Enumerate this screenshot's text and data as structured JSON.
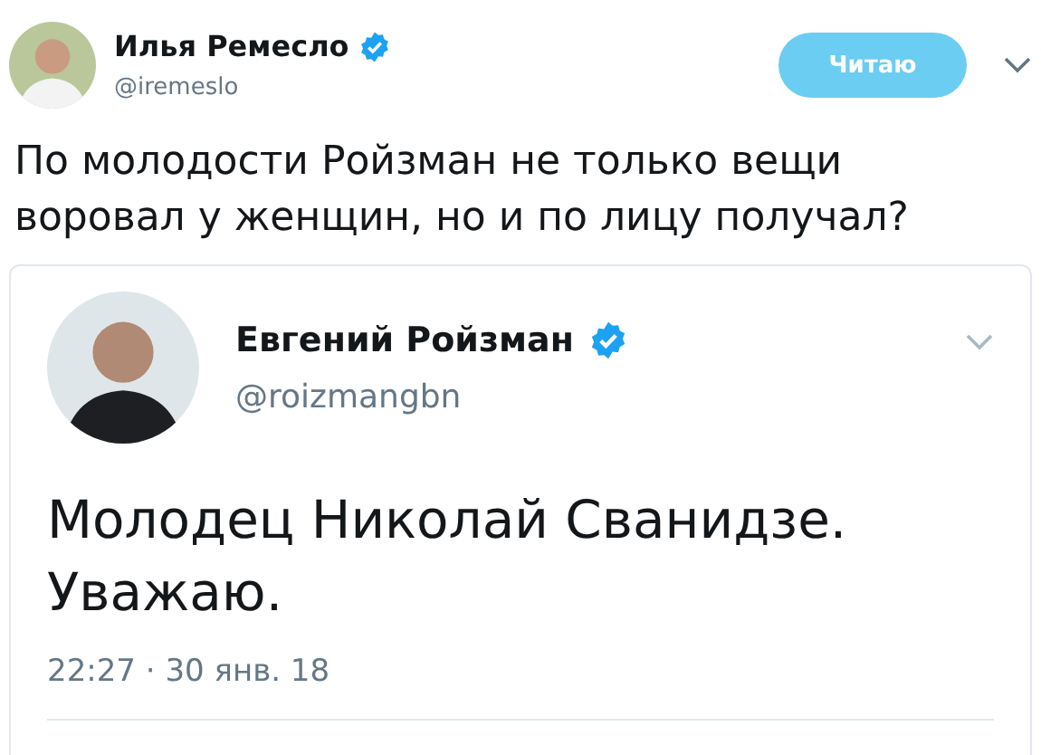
{
  "tweet": {
    "author": {
      "name": "Илья Ремесло",
      "handle": "@iremeslo",
      "verified": true
    },
    "follow_button": {
      "label": "Читаю"
    },
    "text": "По молодости Ройзман не только вещи\nворовал у женщин, но и по лицу получал?",
    "quoted_tweet": {
      "author": {
        "name": "Евгений Ройзман",
        "handle": "@roizmangbn",
        "verified": true
      },
      "text": "Молодец Николай Сванидзе.\nУважаю.",
      "timestamp": "22:27 · 30 янв. 18"
    }
  }
}
